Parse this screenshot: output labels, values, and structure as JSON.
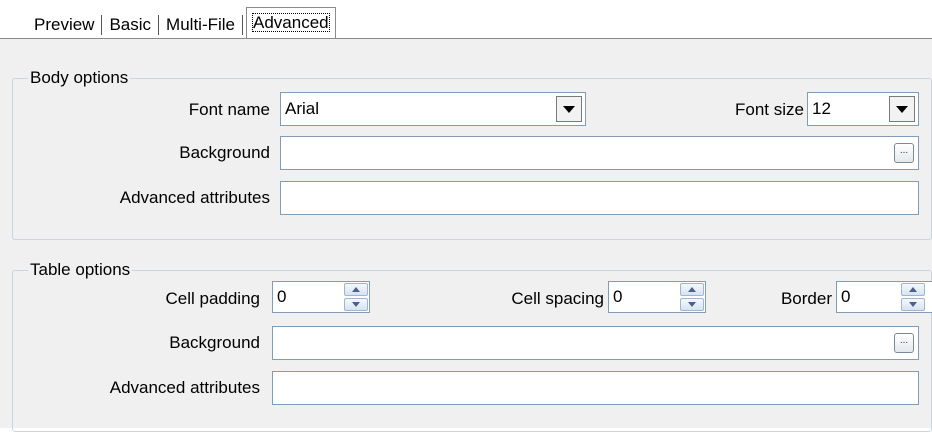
{
  "tabs": [
    {
      "label": "Preview"
    },
    {
      "label": "Basic"
    },
    {
      "label": "Multi-File"
    },
    {
      "label": "Advanced"
    }
  ],
  "body_options": {
    "title": "Body options",
    "font_name_label": "Font name",
    "font_name_value": "Arial",
    "font_size_label": "Font size",
    "font_size_value": "12",
    "background_label": "Background",
    "background_value": "",
    "advanced_label": "Advanced attributes",
    "advanced_value": "",
    "ellipsis": "..."
  },
  "table_options": {
    "title": "Table options",
    "cell_padding_label": "Cell padding",
    "cell_padding_value": "0",
    "cell_spacing_label": "Cell spacing",
    "cell_spacing_value": "0",
    "border_label": "Border",
    "border_value": "0",
    "background_label": "Background",
    "background_value": "",
    "advanced_label": "Advanced attributes",
    "advanced_value": "",
    "ellipsis": "..."
  }
}
